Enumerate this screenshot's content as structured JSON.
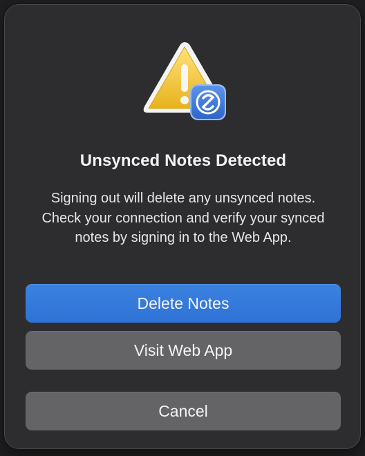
{
  "dialog": {
    "icon": "warning-triangle-with-simplenote-badge-icon",
    "title": "Unsynced Notes Detected",
    "message": "Signing out will delete any unsynced notes. Check your connection and verify your synced notes by signing in to the Web App.",
    "buttons": {
      "delete": "Delete Notes",
      "visit": "Visit Web App",
      "cancel": "Cancel"
    },
    "colors": {
      "primary_button": "#2f72d6",
      "secondary_button": "#646466",
      "warning": "#f3c53a",
      "badge": "#3d78d8"
    }
  }
}
